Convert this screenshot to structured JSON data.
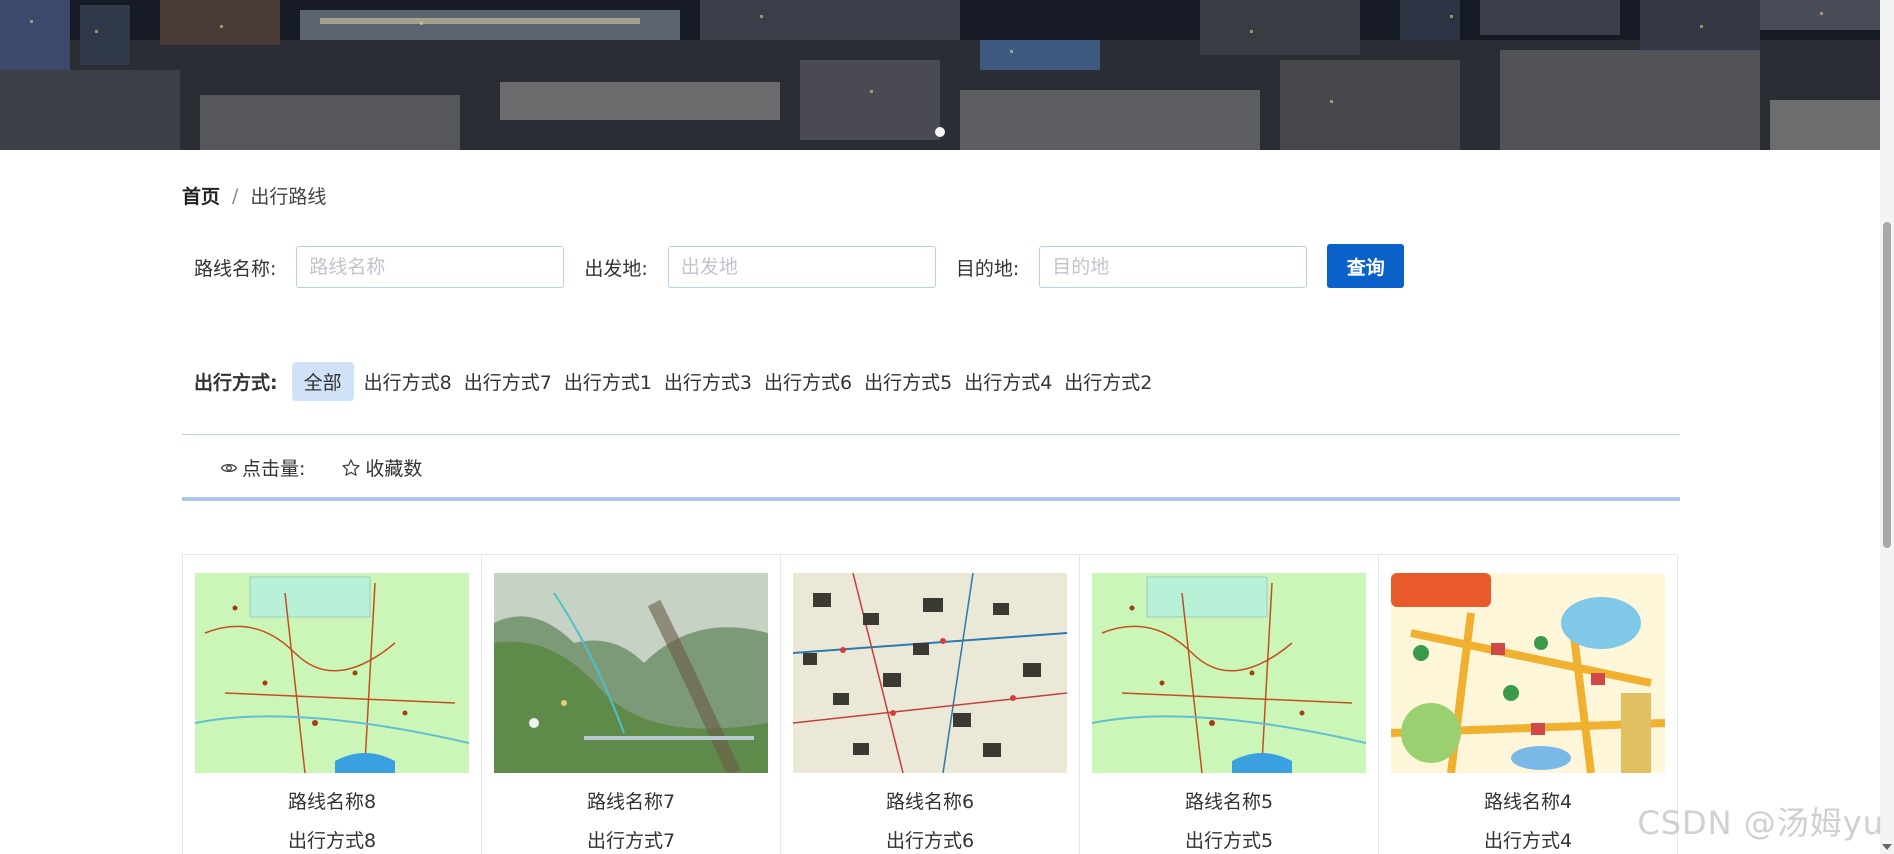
{
  "breadcrumb": {
    "home": "首页",
    "separator": "/",
    "current": "出行路线"
  },
  "search": {
    "route_name_label": "路线名称:",
    "route_name_placeholder": "路线名称",
    "origin_label": "出发地:",
    "origin_placeholder": "出发地",
    "destination_label": "目的地:",
    "destination_placeholder": "目的地",
    "query_button": "查询"
  },
  "filter": {
    "label": "出行方式:",
    "options": [
      "全部",
      "出行方式8",
      "出行方式7",
      "出行方式1",
      "出行方式3",
      "出行方式6",
      "出行方式5",
      "出行方式4",
      "出行方式2"
    ],
    "active": "全部"
  },
  "sort": {
    "views_label": "点击量:",
    "favorites_label": "收藏数"
  },
  "cards": [
    {
      "name": "路线名称8",
      "mode": "出行方式8",
      "thumb": "green-map"
    },
    {
      "name": "路线名称7",
      "mode": "出行方式7",
      "thumb": "mountain-map"
    },
    {
      "name": "路线名称6",
      "mode": "出行方式6",
      "thumb": "photo-wall-map"
    },
    {
      "name": "路线名称5",
      "mode": "出行方式5",
      "thumb": "green-map"
    },
    {
      "name": "路线名称4",
      "mode": "出行方式4",
      "thumb": "illustrated-map"
    }
  ],
  "watermark": "CSDN @汤姆yu",
  "colors": {
    "primary": "#0a61c9",
    "active_chip": "#cfe2f7",
    "divider": "#a9c8ea"
  }
}
